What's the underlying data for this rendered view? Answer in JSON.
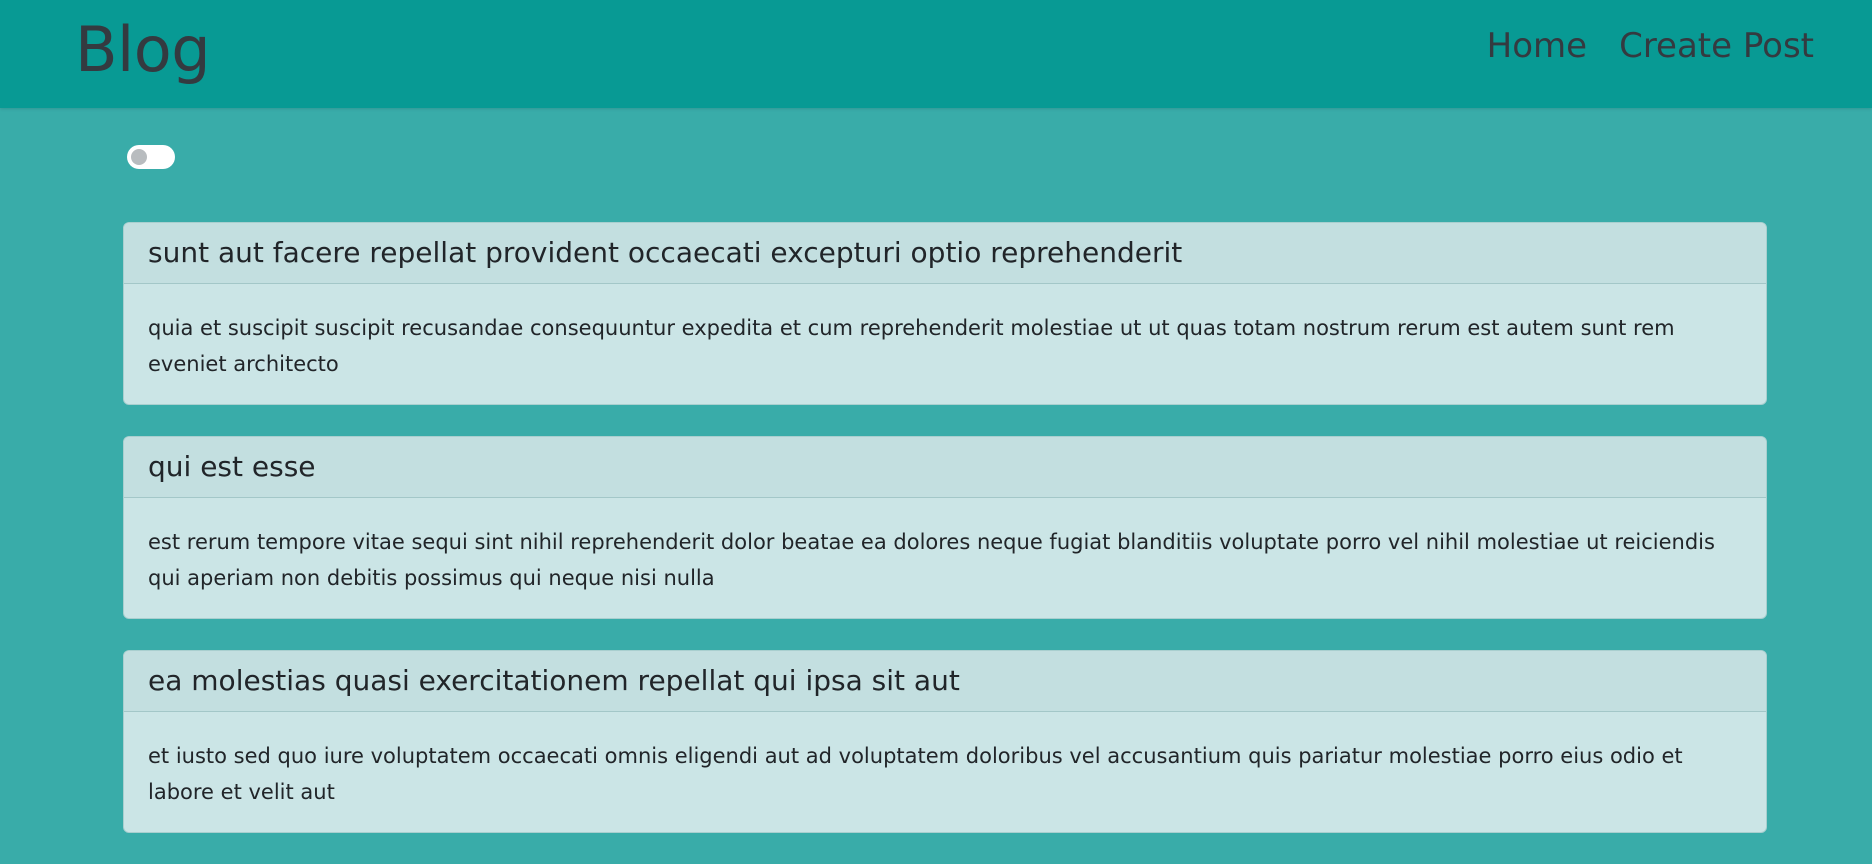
{
  "navbar": {
    "brand": "Blog",
    "links": [
      {
        "label": "Home"
      },
      {
        "label": "Create Post"
      }
    ]
  },
  "theme_toggle": {
    "state": "off"
  },
  "posts": [
    {
      "title": "sunt aut facere repellat provident occaecati excepturi optio reprehenderit",
      "body": "quia et suscipit suscipit recusandae consequuntur expedita et cum reprehenderit molestiae ut ut quas totam nostrum rerum est autem sunt rem eveniet architecto"
    },
    {
      "title": "qui est esse",
      "body": "est rerum tempore vitae sequi sint nihil reprehenderit dolor beatae ea dolores neque fugiat blanditiis voluptate porro vel nihil molestiae ut reiciendis qui aperiam non debitis possimus qui neque nisi nulla"
    },
    {
      "title": "ea molestias quasi exercitationem repellat qui ipsa sit aut",
      "body": "et iusto sed quo iure voluptatem occaecati omnis eligendi aut ad voluptatem doloribus vel accusantium quis pariatur molestiae porro eius odio et labore et velit aut"
    }
  ],
  "colors": {
    "navbar_bg": "#089a94",
    "page_bg": "#39aca9",
    "card_bg": "#cbe5e6",
    "card_header_bg": "#c3dfe0",
    "text": "#212529",
    "nav_text": "#343a40"
  }
}
